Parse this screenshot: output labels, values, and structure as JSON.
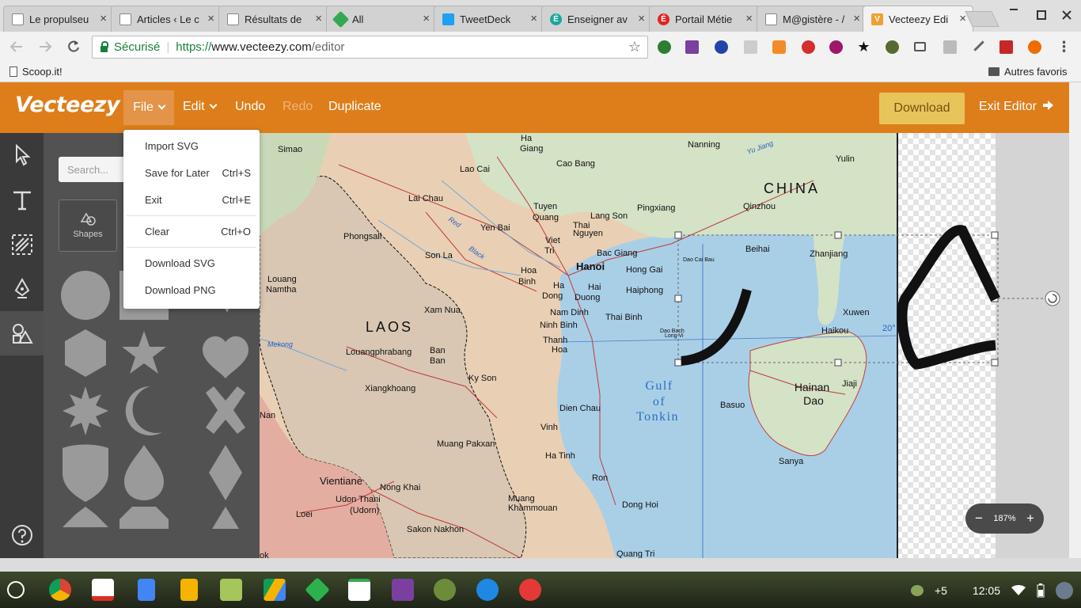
{
  "browser": {
    "tabs": [
      {
        "title": "Le propulseu",
        "favicon_color": "#ffffff"
      },
      {
        "title": "Articles ‹ Le c",
        "favicon_color": "#ffffff"
      },
      {
        "title": "Résultats de",
        "favicon_color": "#ffffff"
      },
      {
        "title": "All",
        "favicon_color": "#34a853"
      },
      {
        "title": "TweetDeck",
        "favicon_color": "#1da1f2"
      },
      {
        "title": "Enseigner av",
        "favicon_color": "#1aa89a"
      },
      {
        "title": "Portail Métie",
        "favicon_color": "#e02424"
      },
      {
        "title": "M@gistère - /",
        "favicon_color": "#ffffff"
      },
      {
        "title": "Vecteezy Edi",
        "favicon_color": "#f0a030"
      }
    ],
    "close_glyph": "×",
    "favicon_letters": [
      "",
      "",
      "",
      "",
      "",
      "É",
      "É",
      "",
      "V"
    ],
    "omnibox": {
      "secure_label": "Sécurisé",
      "protocol": "https://",
      "host": "www.vecteezy.com",
      "path": "/editor"
    },
    "bookmarks": {
      "left": "Scoop.it!",
      "right": "Autres favoris"
    }
  },
  "header": {
    "logo": "Vecteezy",
    "file": "File",
    "edit": "Edit",
    "undo": "Undo",
    "redo": "Redo",
    "duplicate": "Duplicate",
    "download": "Download",
    "exit": "Exit Editor"
  },
  "panel": {
    "search_placeholder": "Search...",
    "shapes_label": "Shapes"
  },
  "file_menu": {
    "items": [
      {
        "label": "Import SVG",
        "shortcut": ""
      },
      {
        "label": "Save for Later",
        "shortcut": "Ctrl+S"
      },
      {
        "label": "Exit",
        "shortcut": "Ctrl+E"
      },
      {
        "label": "Clear",
        "shortcut": "Ctrl+O"
      },
      {
        "label": "Download SVG",
        "shortcut": ""
      },
      {
        "label": "Download PNG",
        "shortcut": ""
      }
    ]
  },
  "map": {
    "countries": {
      "laos": "LAOS",
      "china": "CHINA"
    },
    "gulf": [
      "Gulf",
      "of",
      "Tonkin"
    ],
    "hainan": [
      "Hainan",
      "Dao"
    ],
    "rivers": {
      "red": "Red",
      "black": "Black",
      "mekong": "Mekong",
      "yu_jiang": "Yu Jiang"
    },
    "places": {
      "simao": "Simao",
      "ha_giang_1": "Ha",
      "ha_giang_2": "Giang",
      "nanning": "Nanning",
      "yulin": "Yulin",
      "lao_cai": "Lao Cai",
      "cao_bang": "Cao Bang",
      "lai_chau": "Lai Chau",
      "tuyen_1": "Tuyen",
      "tuyen_2": "Quang",
      "lang_son": "Lang Son",
      "pingxiang": "Pingxiang",
      "qinzhou": "Qinzhou",
      "thai_1": "Thai",
      "thai_2": "Nguyen",
      "yen_bai": "Yen Bai",
      "phongsali": "Phongsali",
      "viet_1": "Viet",
      "viet_2": "Tri",
      "beihai": "Beihai",
      "zhanjiang": "Zhanjiang",
      "bac_giang": "Bac Giang",
      "son_la": "Son La",
      "black": "Black",
      "dao_cai_bau": "Dao Cai Bau",
      "hanoi": "Hanoi",
      "hong_gai": "Hong Gai",
      "hoa_1": "Hoa",
      "hoa_2": "Binh",
      "louang_1": "Louang",
      "louang_2": "Namtha",
      "ha_dong_1": "Ha",
      "ha_dong_2": "Dong",
      "hai_1": "Hai",
      "hai_2": "Duong",
      "haiphong": "Haiphong",
      "xam_nua": "Xam Nua",
      "nam_dinh": "Nam Dinh",
      "thai_binh": "Thai Binh",
      "xuwen": "Xuwen",
      "ninh_binh": "Ninh Binh",
      "dao_bach_1": "Dao Bach",
      "dao_bach_2": "Long Vi",
      "haikou": "Haikou",
      "deg": "20°",
      "thanh_1": "Thanh",
      "thanh_2": "Hoa",
      "louangphrabang": "Louangphrabang",
      "ban_1": "Ban",
      "ban_2": "Ban",
      "ky_son": "Ky Son",
      "xiangkhoang": "Xiangkhoang",
      "jiaji": "Jiaji",
      "basuo": "Basuo",
      "dien_chau": "Dien Chau",
      "nan": "Nan",
      "vinh": "Vinh",
      "muang_pakxan": "Muang Pakxan",
      "ha_tinh": "Ha Tinh",
      "sanya": "Sanya",
      "vientiane": "Vientiane",
      "ron": "Ron",
      "nong_khai": "Nong Khai",
      "udon_1": "Udon Thani",
      "udon_2": "(Udorn)",
      "muang_1": "Muang",
      "muang_2": "Khammouan",
      "dong_hoi": "Dong Hoi",
      "loei": "Loei",
      "sakon": "Sakon Nakhon",
      "ok": "ok",
      "quang_tri": "Quang Tri"
    }
  },
  "zoom": {
    "minus": "−",
    "value": "187%",
    "plus": "+"
  },
  "shelf": {
    "badge": "+5",
    "time": "12:05"
  }
}
